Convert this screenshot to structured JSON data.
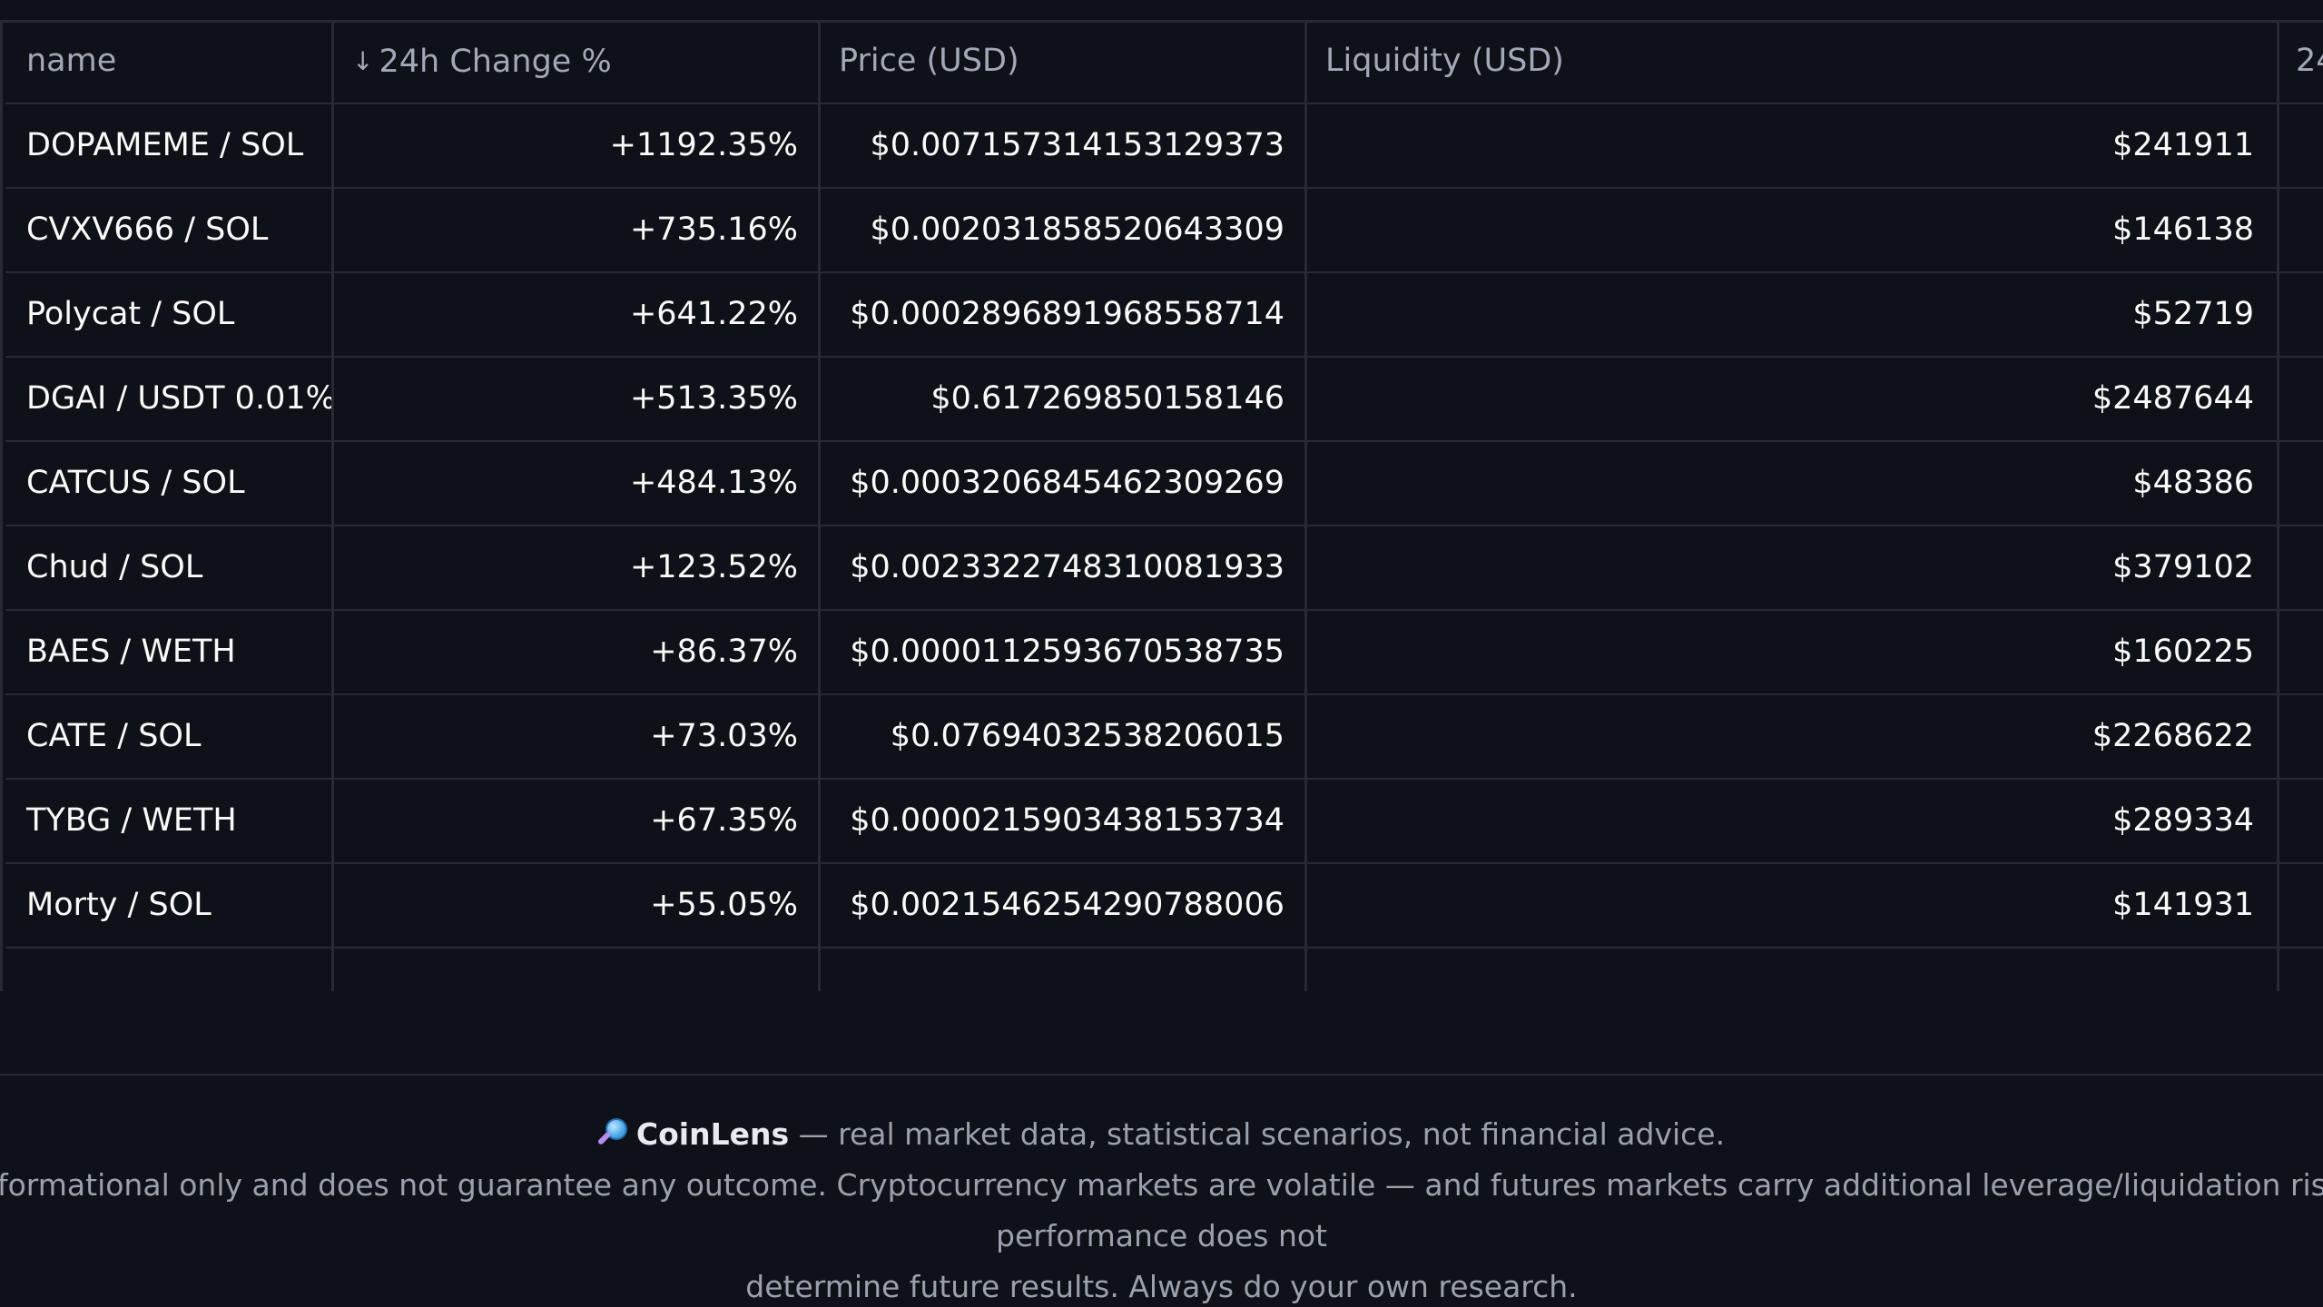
{
  "table": {
    "headers": {
      "name": "name",
      "change": "24h Change %",
      "price": "Price (USD)",
      "liquidity": "Liquidity (USD)",
      "partial": "24"
    },
    "sort_icon": "arrow-down-icon",
    "rows": [
      {
        "name": "DOPAMEME / SOL",
        "change": "+1192.35%",
        "price": "$0.007157314153129373",
        "liquidity": "$241911"
      },
      {
        "name": "CVXV666 / SOL",
        "change": "+735.16%",
        "price": "$0.002031858520643309",
        "liquidity": "$146138"
      },
      {
        "name": "Polycat / SOL",
        "change": "+641.22%",
        "price": "$0.0002896891968558714",
        "liquidity": "$52719"
      },
      {
        "name": "DGAI / USDT 0.01%",
        "change": "+513.35%",
        "price": "$0.617269850158146",
        "liquidity": "$2487644"
      },
      {
        "name": "CATCUS / SOL",
        "change": "+484.13%",
        "price": "$0.0003206845462309269",
        "liquidity": "$48386"
      },
      {
        "name": "Chud / SOL",
        "change": "+123.52%",
        "price": "$0.0023322748310081933",
        "liquidity": "$379102"
      },
      {
        "name": "BAES / WETH",
        "change": "+86.37%",
        "price": "$0.0000112593670538735",
        "liquidity": "$160225"
      },
      {
        "name": "CATE / SOL",
        "change": "+73.03%",
        "price": "$0.07694032538206015",
        "liquidity": "$2268622"
      },
      {
        "name": "TYBG / WETH",
        "change": "+67.35%",
        "price": "$0.0000215903438153734",
        "liquidity": "$289334"
      },
      {
        "name": "Morty / SOL",
        "change": "+55.05%",
        "price": "$0.0021546254290788006",
        "liquidity": "$141931"
      }
    ]
  },
  "footer": {
    "icon": "magnifier-icon",
    "brand": "CoinLens",
    "tagline": " — real market data, statistical scenarios, not financial advice.",
    "disclaimer_line1": "This tool is informational only and does not guarantee any outcome. Cryptocurrency markets are volatile — and futures markets carry additional leverage/liquidation risk — and past performance does not",
    "disclaimer_line2": "determine future results. Always do your own research."
  },
  "colors": {
    "background": "#0e1117",
    "border": "#262a33",
    "header_text": "#a3a8b8",
    "cell_text": "#fafafa",
    "footer_text": "#9aa0ad"
  }
}
